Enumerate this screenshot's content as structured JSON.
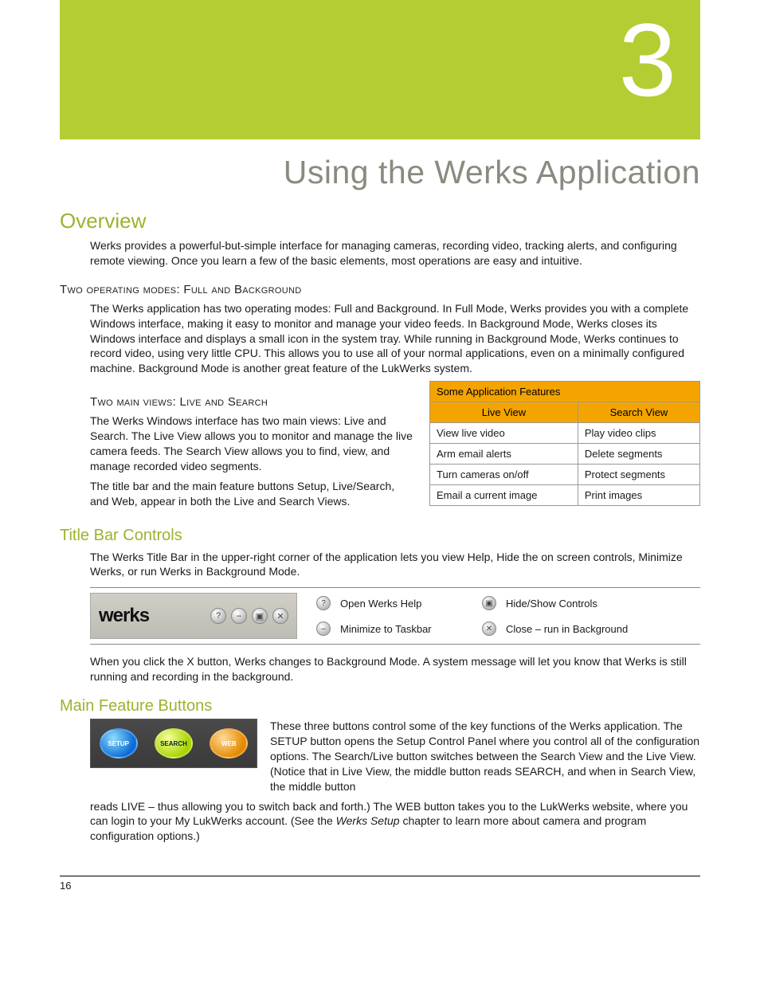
{
  "chapter_number": "3",
  "page_title": "Using the Werks Application",
  "overview": {
    "heading": "Overview",
    "intro": "Werks provides a powerful-but-simple interface for managing cameras, recording video, tracking alerts, and configuring remote viewing. Once you learn a few of the basic elements, most operations are easy and intuitive.",
    "modes_heading": "Two operating modes: Full and Background",
    "modes_body": "The Werks application has two operating modes: Full and Background. In Full Mode, Werks provides you with a complete Windows interface, making it easy to monitor and manage your video feeds. In Background Mode, Werks closes its Windows interface and displays a small icon in the system tray. While running in Background Mode, Werks continues to record video, using very little CPU. This allows you to use all of your normal applications, even on a minimally configured machine. Background Mode is another great feature of the LukWerks system.",
    "views_heading": "Two main views: Live and Search",
    "views_p1": "The Werks Windows interface has two main views: Live and Search. The Live View allows you to monitor and manage the live camera feeds. The Search View allows you to find, view, and manage recorded video segments.",
    "views_p2": "The title bar and the main feature buttons Setup, Live/Search, and Web, appear in both the Live and Search Views."
  },
  "feature_table": {
    "title": "Some Application Features",
    "col1": "Live View",
    "col2": "Search View",
    "rows": [
      {
        "a": "View live video",
        "b": "Play video clips"
      },
      {
        "a": "Arm email alerts",
        "b": "Delete segments"
      },
      {
        "a": "Turn cameras on/off",
        "b": "Protect segments"
      },
      {
        "a": "Email a current image",
        "b": "Print images"
      }
    ]
  },
  "titlebar": {
    "heading": "Title Bar Controls",
    "intro": "The Werks Title Bar in the upper-right corner of the application lets you view Help, Hide the on screen controls, Minimize Werks, or run Werks in Background Mode.",
    "logo": "werks",
    "legend": {
      "help": "Open Werks Help",
      "min": "Minimize to Taskbar",
      "toggle": "Hide/Show Controls",
      "close": "Close – run in Background"
    },
    "after": "When you click the X button, Werks changes to Background Mode. A system message will let you know that Werks is still running and recording in the background."
  },
  "mainbuttons": {
    "heading": "Main Feature Buttons",
    "labels": {
      "setup": "SETUP",
      "search": "SEARCH",
      "web": "WEB"
    },
    "body_1": "These three buttons control some of the key functions of the Werks application. The SETUP button opens the Setup Control Panel where you control all of the configuration options. The Search/Live button switches between the Search View and the Live View. (Notice that in Live View, the middle button reads SEARCH, and when in Search View, the middle button ",
    "body_2": "reads LIVE – thus allowing you to switch back and forth.) The WEB button takes you to the LukWerks website, where you can login to your My LukWerks account. (See the ",
    "body_2_italic": "Werks Setup",
    "body_2_tail": " chapter to learn more about camera and program configuration options.)"
  },
  "page_number": "16"
}
